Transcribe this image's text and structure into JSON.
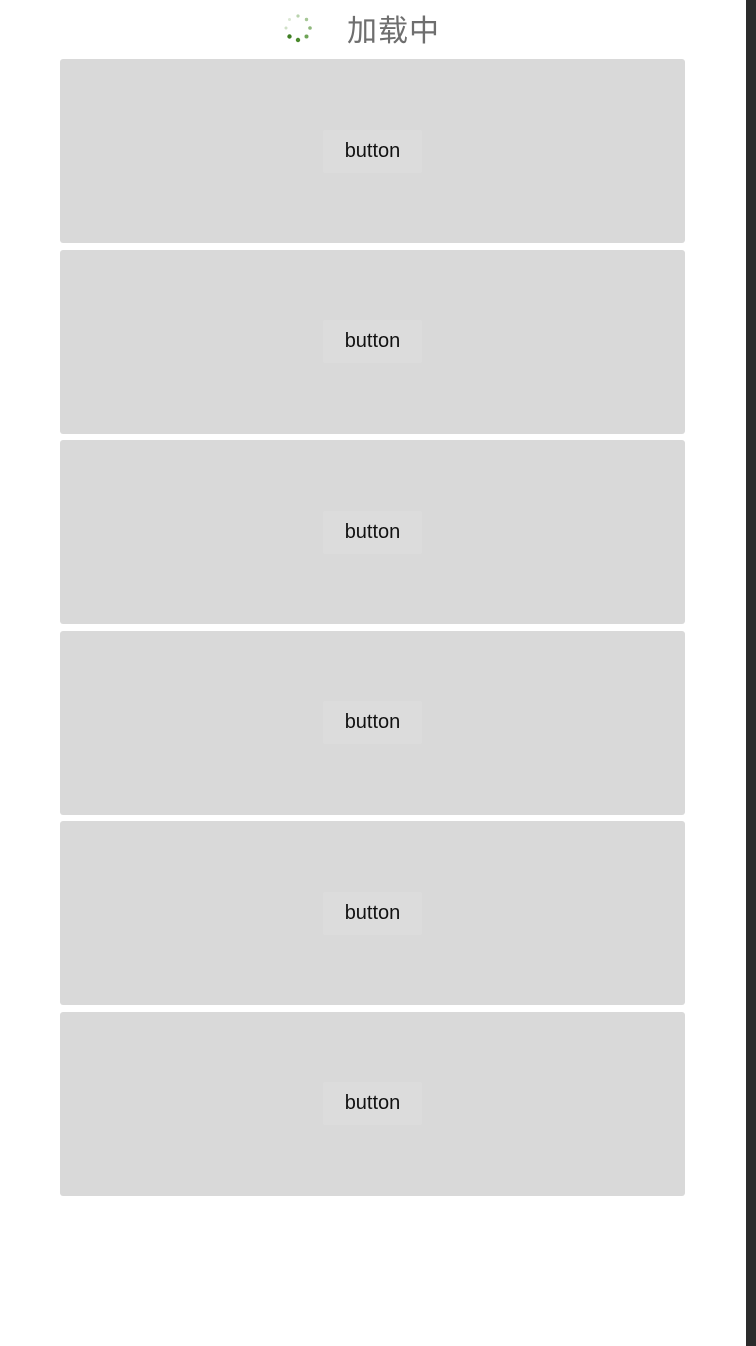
{
  "loading": {
    "text": "加载中",
    "spinner_color": "#4a8a2c"
  },
  "items": [
    {
      "label": "button"
    },
    {
      "label": "button"
    },
    {
      "label": "button"
    },
    {
      "label": "button"
    },
    {
      "label": "button"
    },
    {
      "label": "button"
    }
  ]
}
